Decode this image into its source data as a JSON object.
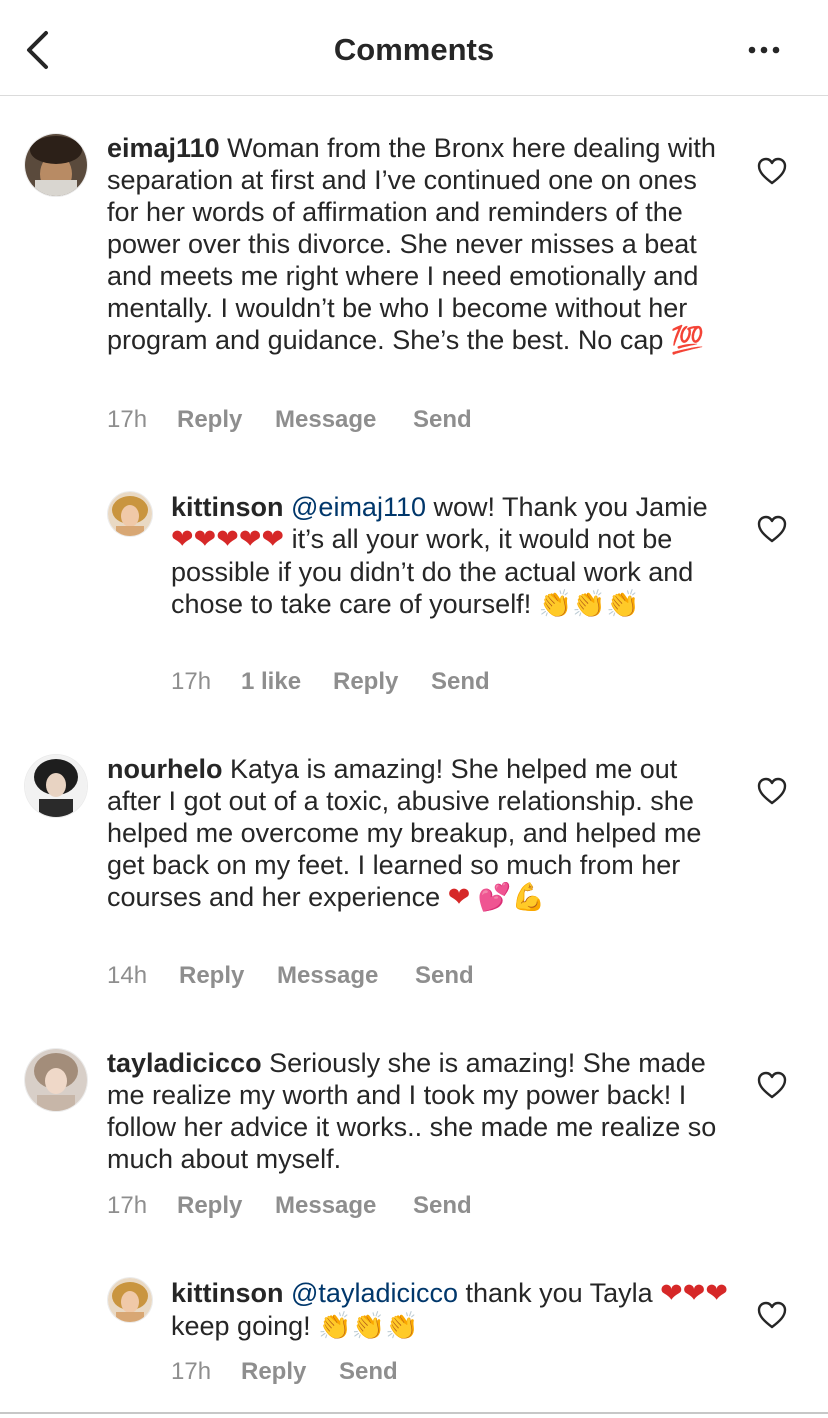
{
  "header": {
    "title": "Comments",
    "back_icon": "chevron-left-icon",
    "more_icon": "more-horizontal-icon"
  },
  "actions": {
    "reply": "Reply",
    "message": "Message",
    "send": "Send"
  },
  "comments": [
    {
      "username": "eimaj110",
      "text": "Woman from the Bronx here dealing with separation at first and I’ve continued one on ones for her words of affirmation and reminders of the power over this divorce. She never misses a beat and meets me right where I need emotionally and mentally. I wouldn’t be who I become without her program and guidance. She’s the best. No cap",
      "emoji": "💯",
      "time": "17h"
    },
    {
      "username": "kittinson",
      "mention": "@eimaj110",
      "text_before": "wow! Thank you Jamie",
      "hearts": "❤❤❤❤❤",
      "text_after": "it’s all your work, it would not be possible if you didn’t do the actual work and chose to take care of yourself!",
      "clap": "👏👏👏",
      "time": "17h",
      "likes": "1 like"
    },
    {
      "username": "nourhelo",
      "text": "Katya is amazing! She helped me out after I got out of a toxic, abusive relationship. she helped me overcome my breakup, and helped me get back on my feet. I learned so much from her courses and her experience",
      "heart": "❤",
      "emoji": "💕💪",
      "time": "14h"
    },
    {
      "username": "tayladicicco",
      "text": "Seriously she is amazing! She made me realize my worth and I took my power back! I follow her advice it works.. she made me realize so much about myself.",
      "time": "17h"
    },
    {
      "username": "kittinson",
      "mention": "@tayladicicco",
      "text_before": "thank you Tayla",
      "hearts": "❤❤❤",
      "text_after": "keep going!",
      "clap": "👏👏👏",
      "time": "17h"
    }
  ],
  "colors": {
    "text": "#262626",
    "secondary": "#8e8e8e",
    "mention": "#00376b",
    "heart": "#d62828"
  }
}
